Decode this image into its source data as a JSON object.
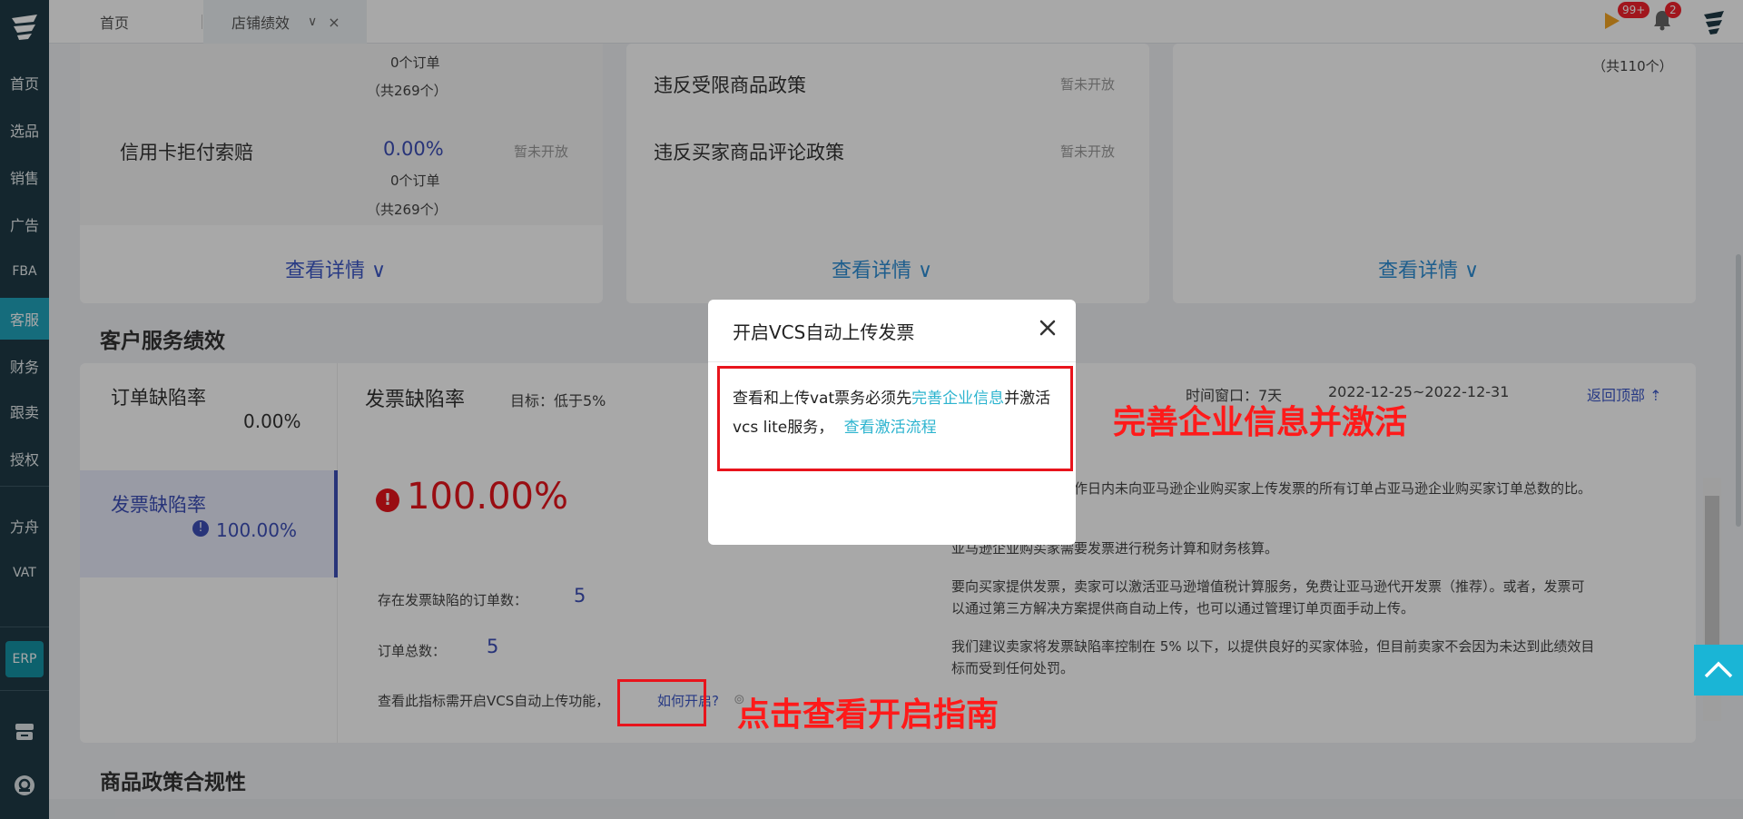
{
  "sidebar": {
    "items": [
      {
        "label": "首页"
      },
      {
        "label": "选品"
      },
      {
        "label": "销售"
      },
      {
        "label": "广告"
      },
      {
        "label": "FBA"
      },
      {
        "label": "客服"
      },
      {
        "label": "财务"
      },
      {
        "label": "跟卖"
      },
      {
        "label": "授权"
      },
      {
        "label": "方舟"
      },
      {
        "label": "VAT"
      }
    ],
    "erp_label": "ERP",
    "active_color": "#20a4bd"
  },
  "tabs": {
    "home": "首页",
    "active": "店铺绩效"
  },
  "header_badges": {
    "messages": "99+",
    "notifications": "2"
  },
  "panel_left": {
    "row1_orders": "0个订单",
    "row1_total": "（共269个）",
    "row2_label": "信用卡拒付索赔",
    "row2_value": "0.00%",
    "row2_status": "暂未开放",
    "row2_orders": "0个订单",
    "row2_total": "（共269个）",
    "detail": "查看详情 ∨"
  },
  "panel_mid": {
    "row1_label": "违反受限商品政策",
    "row1_status": "暂未开放",
    "row2_label": "违反买家商品评论政策",
    "row2_status": "暂未开放",
    "detail": "查看详情 ∨"
  },
  "panel_right": {
    "total": "（共110个）",
    "detail": "查看详情 ∨"
  },
  "customer_service": {
    "title": "客户服务绩效",
    "nav": [
      {
        "label": "订单缺陷率",
        "value": "0.00%"
      },
      {
        "label": "发票缺陷率",
        "value": "100.00%"
      }
    ],
    "metric_title": "发票缺陷率",
    "target": "目标：低于5%",
    "window": "时间窗口：7天",
    "date_range": "2022-12-25~2022-12-31",
    "back_top": "返回顶部",
    "big_value": "100.00%",
    "defect_orders_label": "存在发票缺陷的订单数：",
    "defect_orders_value": "5",
    "total_orders_label": "订单总数：",
    "total_orders_value": "5",
    "vcs_note": "查看此指标需开启VCS自动上传功能，",
    "how_link": "如何开启?",
    "desc1": "提在发货后的一个工作日内未向亚马逊企业购买家上传发票的所有订单占亚马逊企业购买家订单总数的比。",
    "desc1_line2": "比。",
    "desc2": "亚马逊企业购买家需要发票进行税务计算和财务核算。",
    "desc3_l1": "要向买家提供发票，卖家可以激活亚马逊增值税计算服务，免费让亚马逊代开发票（推荐）。或者，发票可",
    "desc3_l2": "以通过第三方解决方案提供商自动上传，也可以通过管理订单页面手动上传。",
    "desc4_l1": "我们建议卖家将发票缺陷率控制在 5% 以下，以提供良好的买家体验，但目前卖家不会因为未达到此绩效目",
    "desc4_l2": "标而受到任何处罚。"
  },
  "next_section_title": "商品政策合规性",
  "modal": {
    "title": "开启VCS自动上传发票",
    "body_pre": "查看和上传vat票务必须先",
    "body_link1": "完善企业信息",
    "body_mid": "并激活vcs lite服务，",
    "body_link2": "查看激活流程"
  },
  "annotations": {
    "top_text": "完善企业信息并激活",
    "bottom_text": "点击查看开启指南"
  }
}
